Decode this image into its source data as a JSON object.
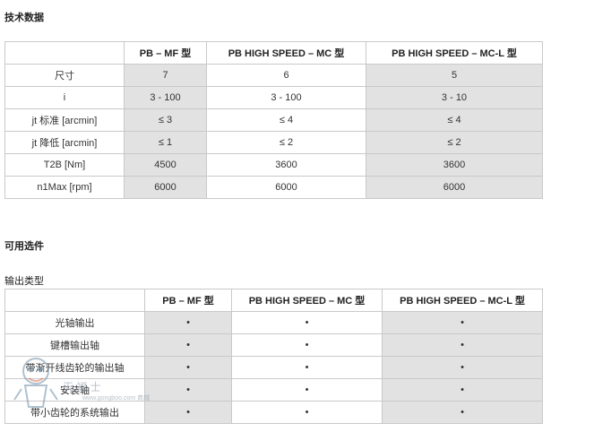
{
  "section1": {
    "title": "技术数据",
    "columns": [
      "",
      "PB – MF 型",
      "PB HIGH SPEED – MC 型",
      "PB HIGH SPEED – MC-L 型"
    ],
    "rows": [
      [
        "尺寸",
        "7",
        "6",
        "5"
      ],
      [
        "i",
        "3 - 100",
        "3 - 100",
        "3 - 10"
      ],
      [
        "jt 标准 [arcmin]",
        "≤ 3",
        "≤ 4",
        "≤ 4"
      ],
      [
        "jt 降低 [arcmin]",
        "≤ 1",
        "≤ 2",
        "≤ 2"
      ],
      [
        "T2B [Nm]",
        "4500",
        "3600",
        "3600"
      ],
      [
        "n1Max [rpm]",
        "6000",
        "6000",
        "6000"
      ]
    ]
  },
  "section2": {
    "title": "可用选件",
    "subtitle": "输出类型",
    "columns": [
      "",
      "PB – MF 型",
      "PB HIGH SPEED – MC 型",
      "PB HIGH SPEED – MC-L 型"
    ],
    "rows": [
      [
        "光轴输出",
        "•",
        "•",
        "•"
      ],
      [
        "键槽输出轴",
        "•",
        "•",
        "•"
      ],
      [
        "带渐开线齿轮的输出轴",
        "•",
        "•",
        "•"
      ],
      [
        "安装轴",
        "•",
        "•",
        "•"
      ],
      [
        "带小齿轮的系统输出",
        "•",
        "•",
        "•"
      ]
    ]
  },
  "watermark": {
    "text": "天 福 士",
    "subtext": "www.gongboo.com 商城"
  },
  "colors": {
    "shade": "#e2e2e2",
    "border": "#c9c9c9"
  }
}
